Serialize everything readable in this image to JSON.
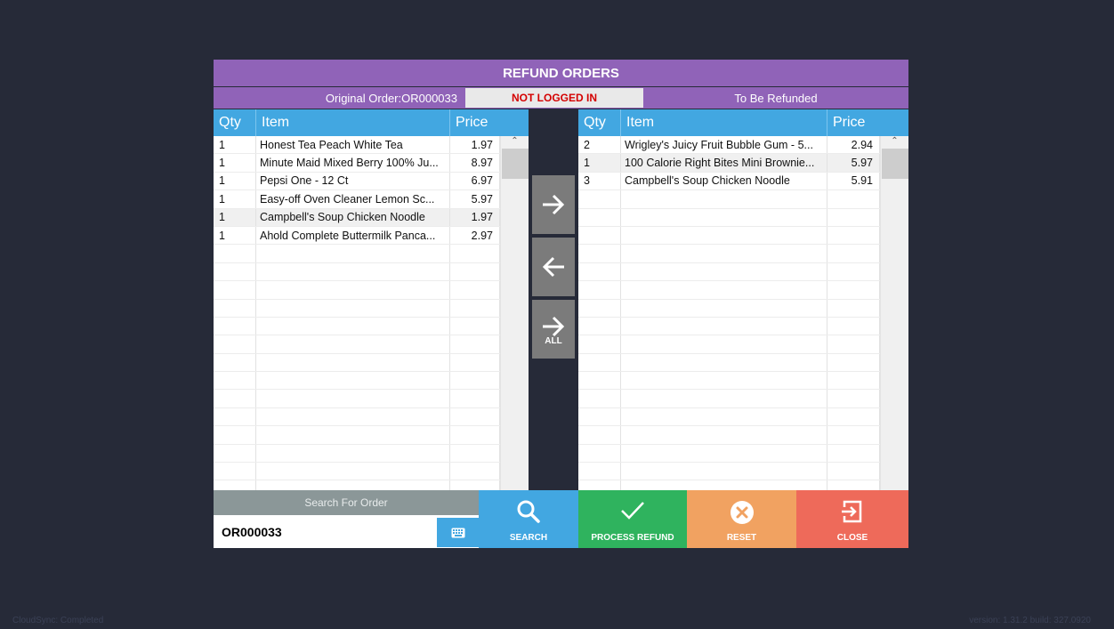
{
  "title": "REFUND ORDERS",
  "subheader": {
    "original_order": "Original Order:OR000033",
    "login_status": "NOT LOGGED IN",
    "to_be_refunded": "To Be Refunded"
  },
  "columns": {
    "qty": "Qty",
    "item": "Item",
    "price": "Price"
  },
  "left_items": [
    {
      "qty": "1",
      "item": "Honest Tea Peach White Tea",
      "price": "1.97"
    },
    {
      "qty": "1",
      "item": "Minute Maid Mixed Berry 100% Ju...",
      "price": "8.97"
    },
    {
      "qty": "1",
      "item": "Pepsi One - 12 Ct",
      "price": "6.97"
    },
    {
      "qty": "1",
      "item": "Easy-off Oven Cleaner Lemon Sc...",
      "price": "5.97"
    },
    {
      "qty": "1",
      "item": "Campbell's Soup Chicken Noodle",
      "price": "1.97"
    },
    {
      "qty": "1",
      "item": "Ahold Complete Buttermilk Panca...",
      "price": "2.97"
    }
  ],
  "right_items": [
    {
      "qty": "2",
      "item": "Wrigley's Juicy Fruit Bubble Gum - 5...",
      "price": "2.94"
    },
    {
      "qty": "1",
      "item": "100 Calorie Right Bites Mini Brownie...",
      "price": "5.97"
    },
    {
      "qty": "3",
      "item": "Campbell's Soup Chicken Noodle",
      "price": "5.91"
    }
  ],
  "move_buttons": {
    "all_label": "ALL"
  },
  "search": {
    "label": "Search For Order",
    "value": "OR000033"
  },
  "actions": {
    "search": "SEARCH",
    "process_refund": "PROCESS REFUND",
    "reset": "RESET",
    "close": "CLOSE"
  },
  "footer": {
    "sync_status": "CloudSync: Completed",
    "version": "version: 1.31.2 build: 327.0920"
  },
  "colors": {
    "background": "#262a38",
    "header_purple": "#9063b8",
    "grid_header_blue": "#42a7e1",
    "process_green": "#2fb35e",
    "reset_orange": "#f1a261",
    "close_red": "#ee6a5a",
    "status_red": "#d40000"
  }
}
